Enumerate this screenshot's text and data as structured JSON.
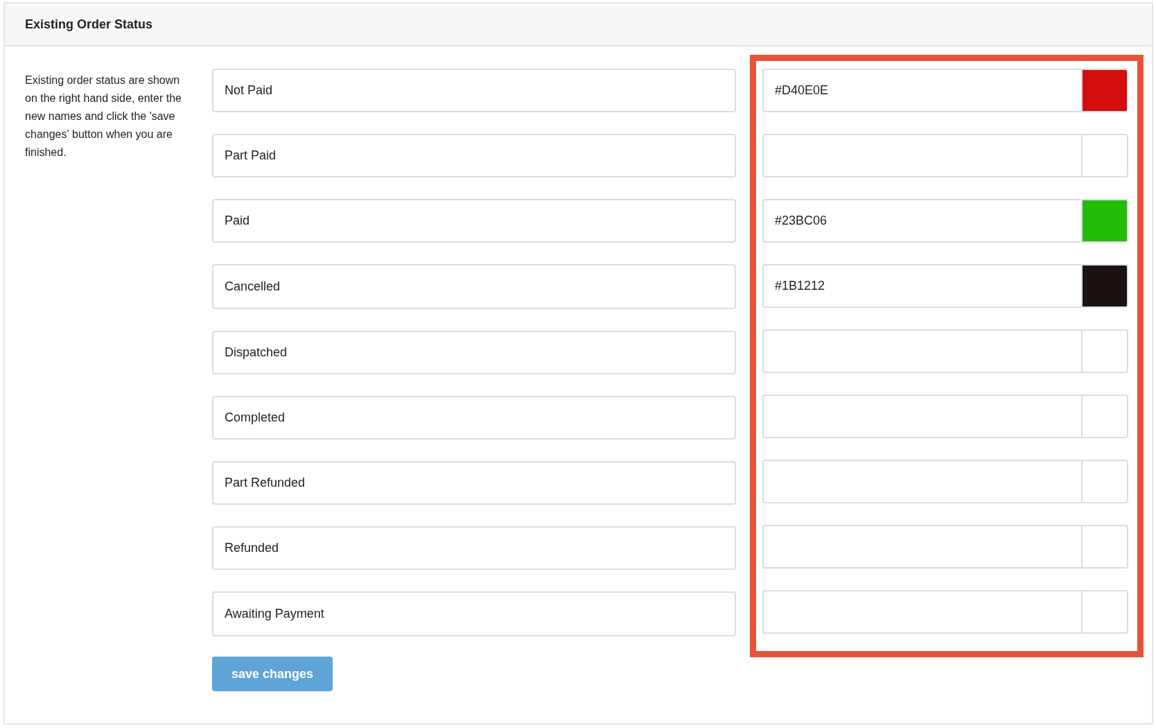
{
  "panel": {
    "title": "Existing Order Status"
  },
  "description": "Existing order status are shown on the right hand side, enter the new names and click the 'save changes' button when you are finished.",
  "statuses": [
    {
      "name": "Not Paid",
      "color_value": "#D40E0E",
      "color": "#d40e0e"
    },
    {
      "name": "Part Paid"
    },
    {
      "name": "Paid",
      "color_value": "#23BC06",
      "color": "#23bc06"
    },
    {
      "name": "Cancelled",
      "color_value": "#1B1212",
      "color": "#1b1212"
    },
    {
      "name": "Dispatched"
    },
    {
      "name": "Completed"
    },
    {
      "name": "Part Refunded"
    },
    {
      "name": "Refunded"
    },
    {
      "name": "Awaiting Payment"
    }
  ],
  "save_button": "save changes"
}
